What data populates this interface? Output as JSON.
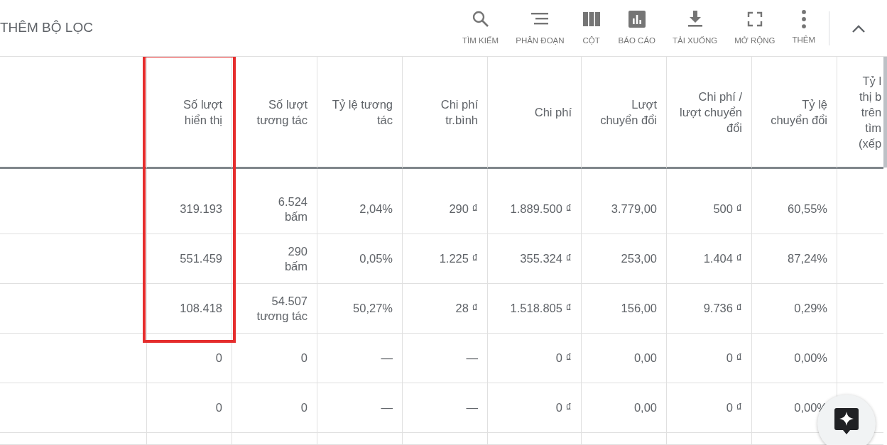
{
  "toolbar": {
    "filter_label": "THÊM BỘ LỌC",
    "actions": [
      {
        "kind": "search",
        "label": "TÌM KIẾM"
      },
      {
        "kind": "segment",
        "label": "PHÂN ĐOẠN"
      },
      {
        "kind": "columns",
        "label": "CỘT"
      },
      {
        "kind": "report",
        "label": "BÁO CÁO"
      },
      {
        "kind": "download",
        "label": "TẢI XUỐNG"
      },
      {
        "kind": "expand",
        "label": "MỞ RỘNG"
      },
      {
        "kind": "more",
        "label": "THÊM"
      }
    ]
  },
  "table": {
    "columns": [
      {
        "label": "Số lượt\nhiển thị",
        "highlighted": true
      },
      {
        "label": "Số lượt\ntương tác",
        "highlighted": false
      },
      {
        "label": "Tỷ lệ tương\ntác",
        "highlighted": false
      },
      {
        "label": "Chi phí\ntr.bình",
        "highlighted": false
      },
      {
        "label": "Chi phí",
        "highlighted": false
      },
      {
        "label": "Lượt\nchuyển đổi",
        "highlighted": false
      },
      {
        "label": "Chi phí /\nlượt chuyển\nđổi",
        "highlighted": false
      },
      {
        "label": "Tỷ lệ\nchuyển đổi",
        "highlighted": false
      },
      {
        "label": "Tỷ l\nthị b\ntrên\ntìm\n(xếp",
        "highlighted": false
      }
    ],
    "rows": [
      {
        "cells": [
          {
            "value": "319.193"
          },
          {
            "value": "6.524",
            "unit": "bấm"
          },
          {
            "value": "2,04%"
          },
          {
            "value": "290 ₫"
          },
          {
            "value": "1.889.500 ₫"
          },
          {
            "value": "3.779,00"
          },
          {
            "value": "500 ₫"
          },
          {
            "value": "60,55%"
          }
        ]
      },
      {
        "cells": [
          {
            "value": "551.459"
          },
          {
            "value": "290",
            "unit": "bấm"
          },
          {
            "value": "0,05%"
          },
          {
            "value": "1.225 ₫"
          },
          {
            "value": "355.324 ₫"
          },
          {
            "value": "253,00"
          },
          {
            "value": "1.404 ₫"
          },
          {
            "value": "87,24%"
          }
        ]
      },
      {
        "cells": [
          {
            "value": "108.418"
          },
          {
            "value": "54.507",
            "unit": "tương tác"
          },
          {
            "value": "50,27%"
          },
          {
            "value": "28 ₫"
          },
          {
            "value": "1.518.805 ₫"
          },
          {
            "value": "156,00"
          },
          {
            "value": "9.736 ₫"
          },
          {
            "value": "0,29%"
          }
        ]
      },
      {
        "cells": [
          {
            "value": "0"
          },
          {
            "value": "0"
          },
          {
            "value": "—"
          },
          {
            "value": "—"
          },
          {
            "value": "0 ₫"
          },
          {
            "value": "0,00"
          },
          {
            "value": "0 ₫"
          },
          {
            "value": "0,00%"
          }
        ]
      },
      {
        "cells": [
          {
            "value": "0"
          },
          {
            "value": "0"
          },
          {
            "value": "—"
          },
          {
            "value": "—"
          },
          {
            "value": "0 ₫"
          },
          {
            "value": "0,00"
          },
          {
            "value": "0 ₫"
          },
          {
            "value": "0,00%"
          }
        ]
      }
    ]
  }
}
